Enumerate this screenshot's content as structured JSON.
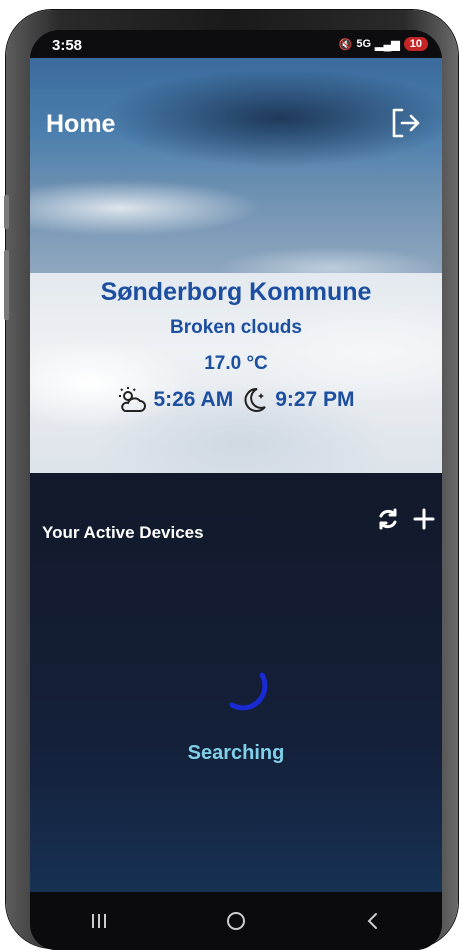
{
  "status_bar": {
    "time": "3:58",
    "network": "5G",
    "battery": "10"
  },
  "header": {
    "title": "Home",
    "logout_icon": "logout-icon"
  },
  "weather": {
    "location": "Sønderborg Kommune",
    "description": "Broken clouds",
    "temperature": "17.0 °C",
    "sunrise": "5:26 AM",
    "sunset": "9:27 PM"
  },
  "devices": {
    "title": "Your Active Devices",
    "refresh_icon": "refresh-icon",
    "add_icon": "plus-icon",
    "status": "Searching"
  },
  "colors": {
    "accent_text": "#1c4fa0",
    "searching_text": "#7fd0e8",
    "spinner": "#1a2bd6"
  }
}
